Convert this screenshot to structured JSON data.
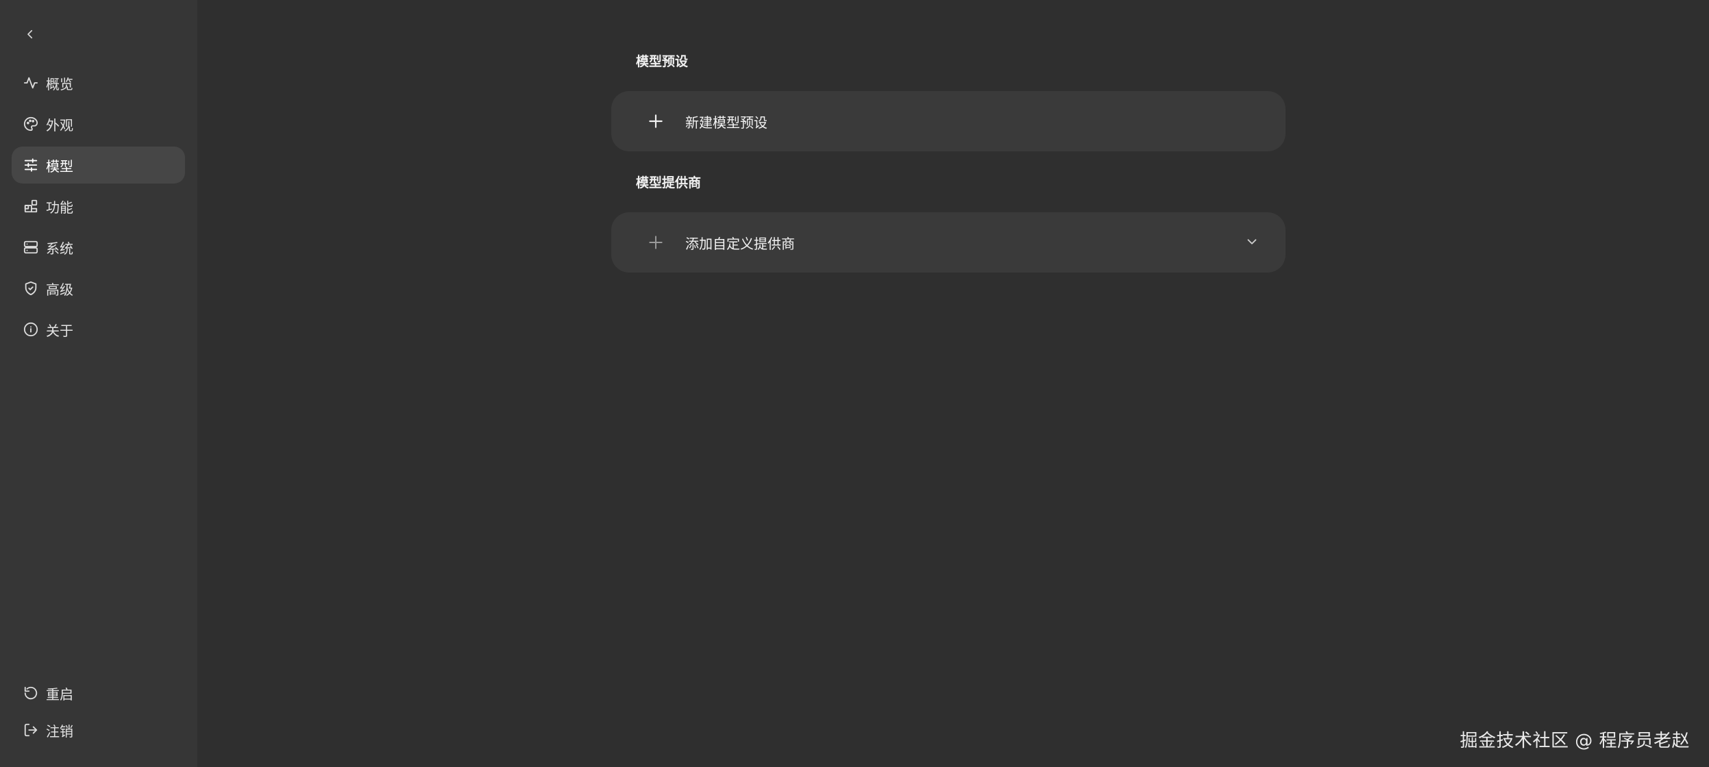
{
  "sidebar": {
    "back_icon": "chevron-left-icon",
    "items": [
      {
        "label": "概览",
        "icon": "activity-icon"
      },
      {
        "label": "外观",
        "icon": "palette-icon"
      },
      {
        "label": "模型",
        "icon": "sliders-icon",
        "active": true
      },
      {
        "label": "功能",
        "icon": "blocks-icon"
      },
      {
        "label": "系统",
        "icon": "server-icon"
      },
      {
        "label": "高级",
        "icon": "shield-icon"
      },
      {
        "label": "关于",
        "icon": "info-icon"
      }
    ],
    "bottom_items": [
      {
        "label": "重启",
        "icon": "rotate-ccw-icon"
      },
      {
        "label": "注销",
        "icon": "logout-icon"
      }
    ]
  },
  "main": {
    "presets": {
      "title": "模型预设",
      "new_label": "新建模型预设"
    },
    "providers": {
      "title": "模型提供商",
      "add_label": "添加自定义提供商"
    }
  },
  "watermark": "掘金技术社区 @ 程序员老赵",
  "colors": {
    "background": "#2f2f2f",
    "sidebar": "#363636",
    "active_item": "#464646",
    "card": "#3a3a3a"
  }
}
